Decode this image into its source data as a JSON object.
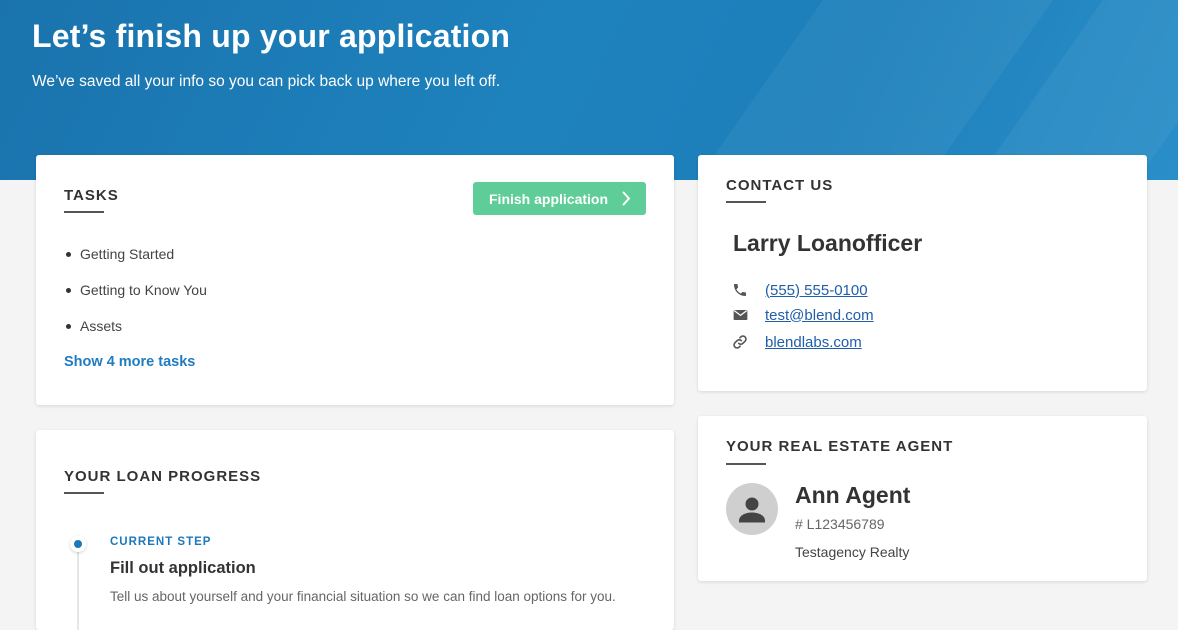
{
  "hero": {
    "title": "Let’s finish up your application",
    "subtitle": "We’ve saved all your info so you can pick back up where you left off.",
    "background_color": "#1d7fba"
  },
  "tasks": {
    "title": "TASKS",
    "finish_button_label": "Finish application",
    "items": [
      "Getting Started",
      "Getting to Know You",
      "Assets"
    ],
    "more_link": "Show 4 more tasks",
    "button_color": "#5fcd98"
  },
  "progress": {
    "title": "YOUR LOAN PROGRESS",
    "current_step_label": "CURRENT STEP",
    "step_title": "Fill out application",
    "step_description": "Tell us about yourself and your financial situation so we can find loan options for you."
  },
  "contact": {
    "title": "CONTACT US",
    "name": "Larry Loanofficer",
    "phone": "(555) 555-0100",
    "email": "test@blend.com",
    "website": "blendlabs.com",
    "icons": [
      "phone-icon",
      "mail-icon",
      "link-icon"
    ]
  },
  "agent": {
    "title": "YOUR REAL ESTATE AGENT",
    "name": "Ann Agent",
    "license": "# L123456789",
    "company": "Testagency Realty"
  },
  "colors": {
    "accent_blue": "#1d78b9",
    "link_blue": "#1f5ea8"
  }
}
